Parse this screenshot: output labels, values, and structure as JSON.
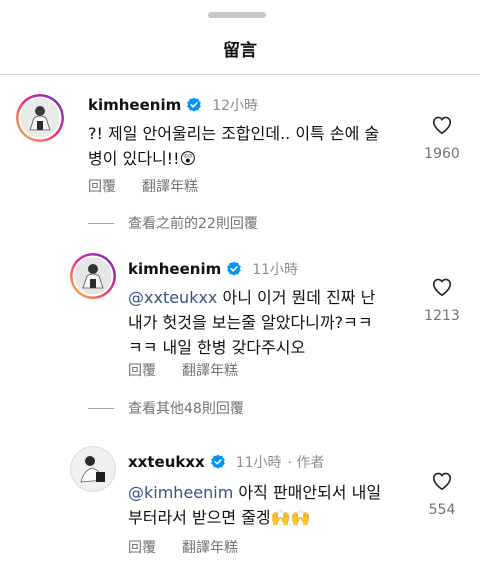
{
  "header": {
    "title": "留言"
  },
  "comments": [
    {
      "username": "kimheenim",
      "time": "12小時",
      "text_line1": "?! 제일 안어울리는 조합인데.. 이특 손에 술",
      "text_line2": "병이 있다니!!😲",
      "likes": "1960",
      "reply_label": "回覆",
      "translate_label": "翻譯年糕"
    }
  ],
  "view_more_1": "查看之前的22則回覆",
  "replies": [
    {
      "username": "kimheenim",
      "time": "11小時",
      "mention": "@xxteukxx",
      "text_line1": " 아니 이거 뭔데 진짜 난",
      "text_line2": "내가 헛것을 보는줄 알았다니까?ㅋㅋ",
      "text_line3": "ㅋㅋ 내일 한병 갖다주시오",
      "likes": "1213",
      "reply_label": "回覆",
      "translate_label": "翻譯年糕"
    },
    {
      "username": "xxteukxx",
      "time": "11小時",
      "author_label": "· 作者",
      "mention": "@kimheenim",
      "text_line1": " 아직 판매안되서 내일",
      "text_line2": "부터라서 받으면 줄겡🙌🙌",
      "likes": "554",
      "reply_label": "回覆",
      "translate_label": "翻譯年糕"
    }
  ],
  "view_more_2": "查看其他48則回覆",
  "icons": {
    "verified": "verified-badge-icon",
    "like": "heart-outline-icon"
  },
  "colors": {
    "verified": "#0095f6",
    "mention": "#385185",
    "secondary_text": "#737373",
    "story_ring_start": "#f9ce34",
    "story_ring_end": "#ee2a7b"
  }
}
